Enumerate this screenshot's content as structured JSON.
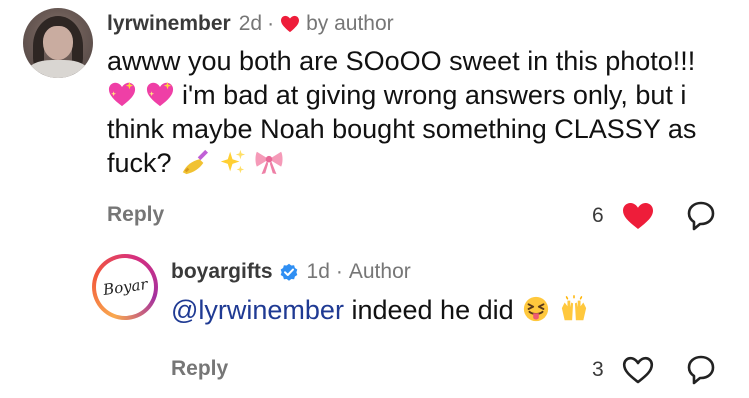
{
  "comment": {
    "username": "lyrwinember",
    "time": "2d",
    "separator": "·",
    "liked_by": "by author",
    "text_1": "awww you both are SOoOO sweet in this photo!!!",
    "text_2": "i'm bad at giving wrong answers only, but i think maybe Noah bought something CLASSY as fuck?",
    "reply_label": "Reply",
    "like_count": "6",
    "liked": true,
    "emojis_1": [
      "sparkling-heart-icon",
      "sparkling-heart-icon"
    ],
    "emojis_2": [
      "nail-polish-icon",
      "sparkles-icon",
      "ribbon-icon"
    ]
  },
  "reply": {
    "username": "boyargifts",
    "verified": true,
    "time": "1d",
    "separator": "·",
    "role": "Author",
    "avatar_text": "Boyar",
    "mention": "@lyrwinember",
    "text": "indeed he did",
    "emojis": [
      "squinting-tongue-face-icon",
      "raising-hands-icon"
    ],
    "reply_label": "Reply",
    "like_count": "3",
    "liked": false
  },
  "colors": {
    "like_red": "#ee1d3a",
    "mention_blue": "#1f3a93",
    "verified_blue": "#2f8ff3",
    "meta_gray": "#767676"
  }
}
